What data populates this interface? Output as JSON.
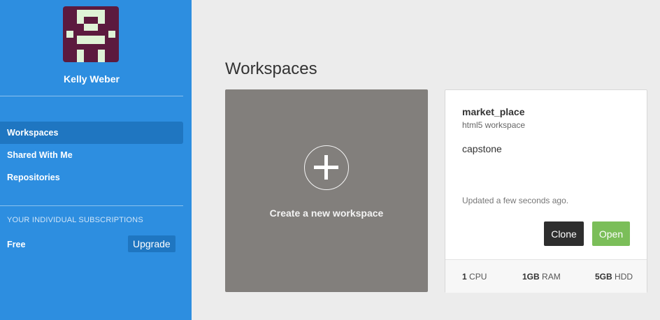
{
  "sidebar": {
    "user_name": "Kelly Weber",
    "nav": [
      {
        "label": "Workspaces",
        "active": true
      },
      {
        "label": "Shared With Me",
        "active": false
      },
      {
        "label": "Repositories",
        "active": false
      }
    ],
    "subscriptions_heading": "YOUR INDIVIDUAL SUBSCRIPTIONS",
    "plan": "Free",
    "upgrade_label": "Upgrade"
  },
  "main": {
    "title": "Workspaces",
    "create_label": "Create a new workspace",
    "workspace": {
      "name": "market_place",
      "type": "html5 workspace",
      "description": "capstone",
      "updated": "Updated a few seconds ago.",
      "clone_label": "Clone",
      "open_label": "Open",
      "specs": [
        {
          "value": "1",
          "unit": "CPU"
        },
        {
          "value": "1GB",
          "unit": "RAM"
        },
        {
          "value": "5GB",
          "unit": "HDD"
        }
      ]
    }
  },
  "colors": {
    "sidebar": "#2d8ee0",
    "sidebar_active": "#1f76c1",
    "avatar_dark": "#5c1a3e",
    "avatar_light": "#dff3d6",
    "create_card": "#827f7c",
    "clone_button": "#2e2e2e",
    "open_button": "#7bbe59"
  }
}
